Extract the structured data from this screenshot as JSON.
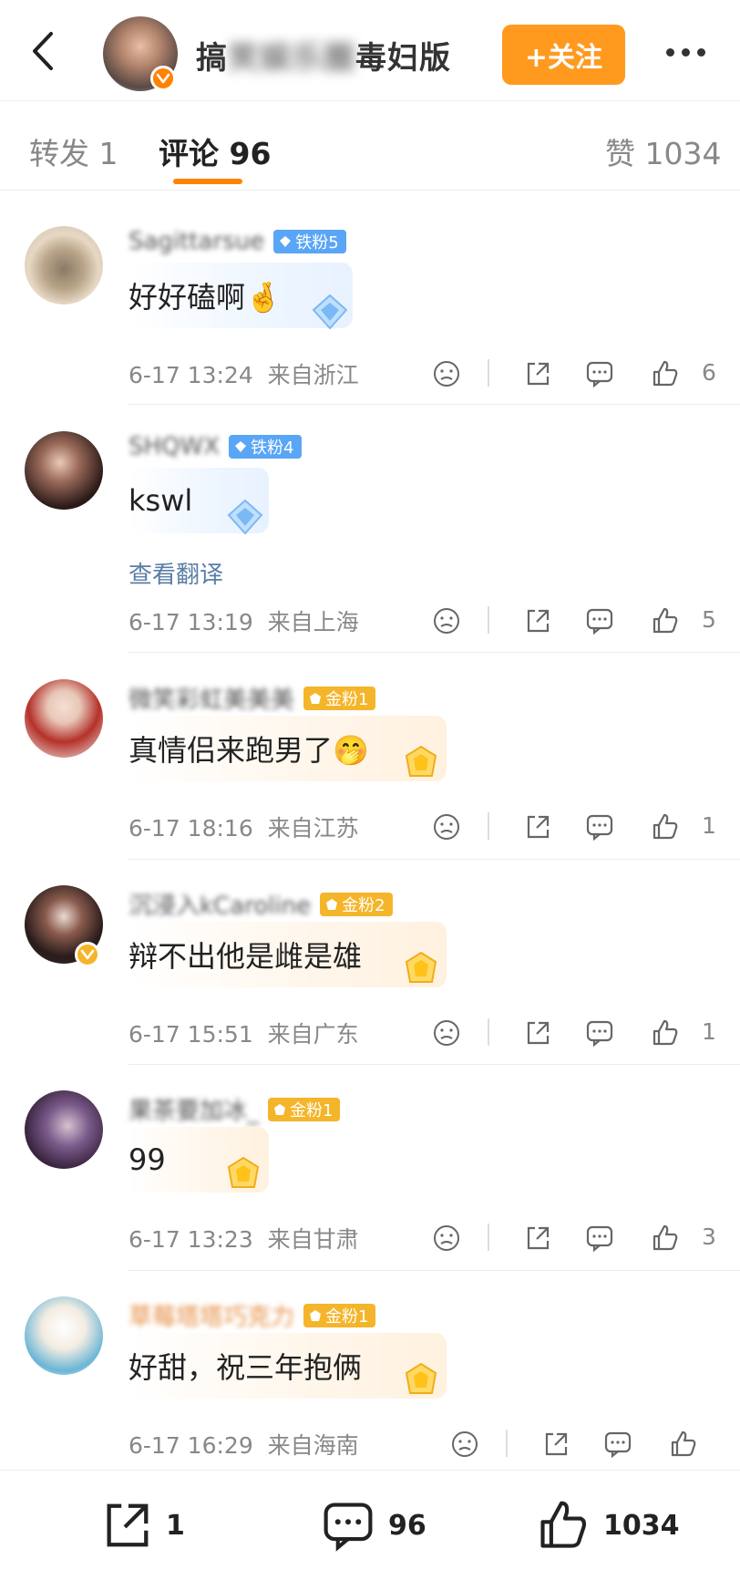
{
  "header": {
    "title_visible": "搞",
    "title_blurred": "笑娱乐圈",
    "title_end": "毒妇版",
    "follow_label": "+关注"
  },
  "tabs": [
    {
      "label": "转发 1"
    },
    {
      "label": "评论 96"
    },
    {
      "label": "赞 1034"
    }
  ],
  "comments": [
    {
      "name": "Sagittarsue",
      "badge": "铁粉5",
      "badge_type": "iron",
      "text": "好好磕啊🤞",
      "time": "6-17 13:24",
      "location": "来自浙江",
      "likes": "6"
    },
    {
      "name": "SHQWX",
      "badge": "铁粉4",
      "badge_type": "iron",
      "text": "kswl",
      "translate": "查看翻译",
      "time": "6-17 13:19",
      "location": "来自上海",
      "likes": "5"
    },
    {
      "name": "微笑彩虹美美美",
      "badge": "金粉1",
      "badge_type": "gold",
      "text": "真情侣来跑男了🤭",
      "time": "6-17 18:16",
      "location": "来自江苏",
      "likes": "1"
    },
    {
      "name": "沉浸入kCaroline",
      "badge": "金粉2",
      "badge_type": "gold",
      "text": "辩不出他是雌是雄",
      "time": "6-17 15:51",
      "location": "来自广东",
      "likes": "1"
    },
    {
      "name": "果茶要加冰_",
      "badge": "金粉1",
      "badge_type": "gold",
      "text": "99",
      "time": "6-17 13:23",
      "location": "来自甘肃",
      "likes": "3"
    },
    {
      "name": "草莓塔塔巧克力",
      "badge": "金粉1",
      "badge_type": "gold",
      "text": "好甜，祝三年抱俩",
      "time": "6-17 16:29",
      "location": "来自海南",
      "likes": ""
    }
  ],
  "bottom_bar": {
    "repost_count": "1",
    "comment_count": "96",
    "like_count": "1034"
  },
  "colors": {
    "accent": "#ff8200",
    "follow_bg": "#ff9a1f",
    "iron_badge": "#5aa6f6",
    "gold_badge": "#f5b52a",
    "translate_link": "#5a7ea6"
  },
  "icons": [
    "back-arrow-icon",
    "more-icon",
    "verified-icon",
    "dislike-icon",
    "share-icon",
    "comment-icon",
    "like-icon"
  ]
}
